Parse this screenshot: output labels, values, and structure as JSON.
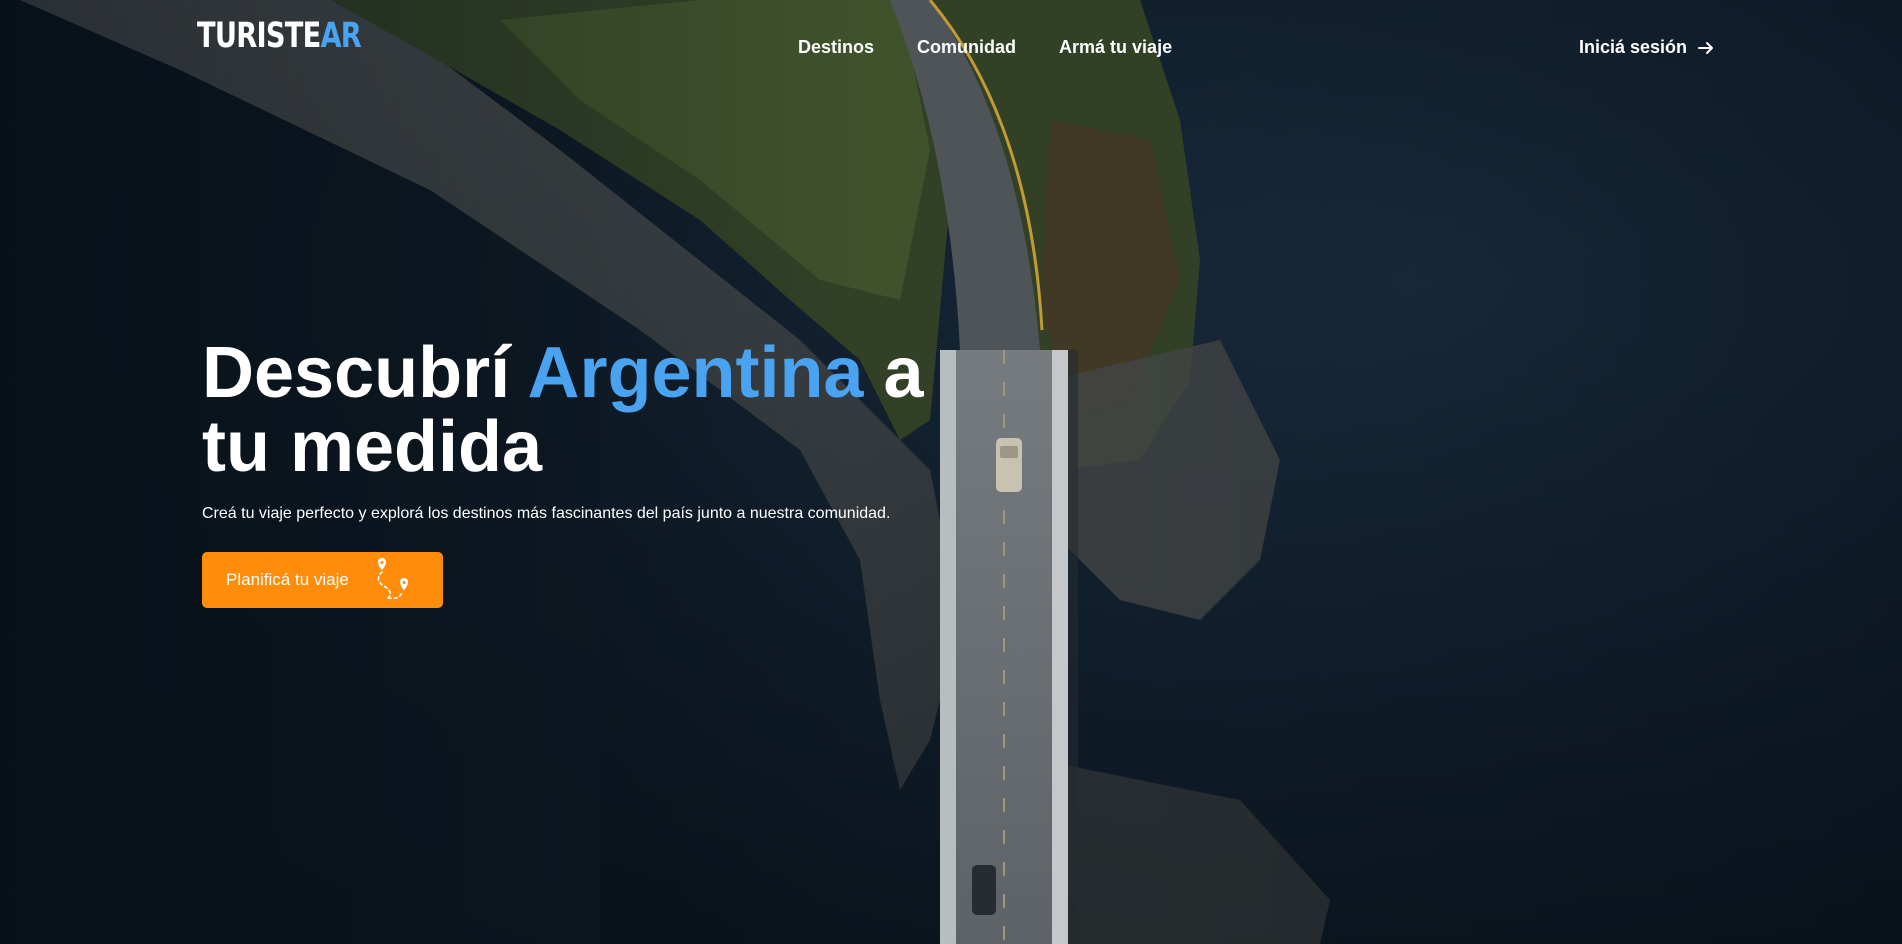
{
  "brand": {
    "name_part1": "TURISTE",
    "name_part2": "AR",
    "logo_icon": "horse-icon"
  },
  "nav": {
    "items": [
      {
        "label": "Destinos"
      },
      {
        "label": "Comunidad"
      },
      {
        "label": "Armá tu viaje"
      }
    ],
    "login_label": "Iniciá sesión",
    "login_icon": "arrow-right-icon"
  },
  "hero": {
    "title_part1": "Descubrí",
    "title_accent": "Argentina",
    "title_part2": "a",
    "title_line2": "tu medida",
    "subtitle": "Creá tu viaje perfecto y explorá los destinos más fascinantes del país junto a nuestra comunidad.",
    "cta_label": "Planificá tu viaje",
    "cta_icon": "route-map-pin-icon"
  },
  "colors": {
    "accent_blue": "#4aa3f0",
    "cta_orange": "#ff8c0a",
    "text": "#ffffff"
  }
}
